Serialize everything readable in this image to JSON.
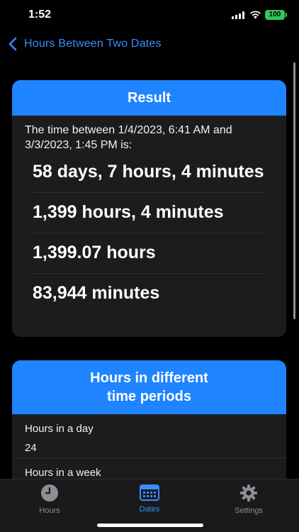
{
  "status_bar": {
    "time": "1:52",
    "battery": "100"
  },
  "nav": {
    "title": "Hours Between Two Dates"
  },
  "result": {
    "header": "Result",
    "intro": "The time between 1/4/2023, 6:41 AM and 3/3/2023, 1:45 PM is:",
    "lines": [
      "58 days, 7 hours, 4 minutes",
      "1,399 hours, 4 minutes",
      "1,399.07 hours",
      "83,944 minutes"
    ]
  },
  "periods": {
    "header_line1": "Hours in different",
    "header_line2": "time periods",
    "rows": [
      {
        "label": "Hours in a day",
        "value": "24"
      },
      {
        "label": "Hours in a week",
        "value": ""
      }
    ]
  },
  "tabs": [
    {
      "label": "Hours",
      "icon": "clock-icon",
      "active": false
    },
    {
      "label": "Dates",
      "icon": "calendar-icon",
      "active": true
    },
    {
      "label": "Settings",
      "icon": "gear-icon",
      "active": false
    }
  ],
  "colors": {
    "accent": "#1f84ff",
    "card": "#1c1c1e",
    "tab_active": "#3a8dff",
    "tab_inactive": "#8e8e93"
  }
}
